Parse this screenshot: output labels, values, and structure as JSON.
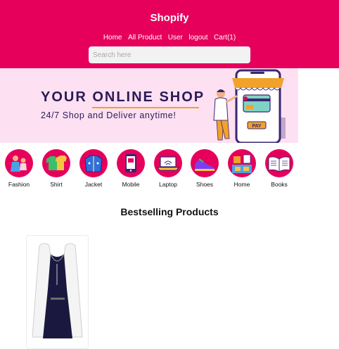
{
  "header": {
    "brand": "Shopify",
    "nav": [
      "Home",
      "All Product",
      "User",
      "logout",
      "Cart(1)"
    ],
    "search_placeholder": "Search here"
  },
  "banner": {
    "title_part1": "YOUR ",
    "title_part2": "ONLINE SHOP",
    "subtitle": "24/7 Shop and Deliver anytime!",
    "pay_label": "PAY"
  },
  "categories": [
    "Fashion",
    "Shirt",
    "Jacket",
    "Mobile",
    "Laptop",
    "Shoes",
    "Home",
    "Books"
  ],
  "section": {
    "title": "Bestselling Products"
  },
  "colors": {
    "brand": "#e6005c",
    "banner_bg": "#fde1f2",
    "banner_text": "#2b1a58",
    "accent": "#f2a22a"
  }
}
